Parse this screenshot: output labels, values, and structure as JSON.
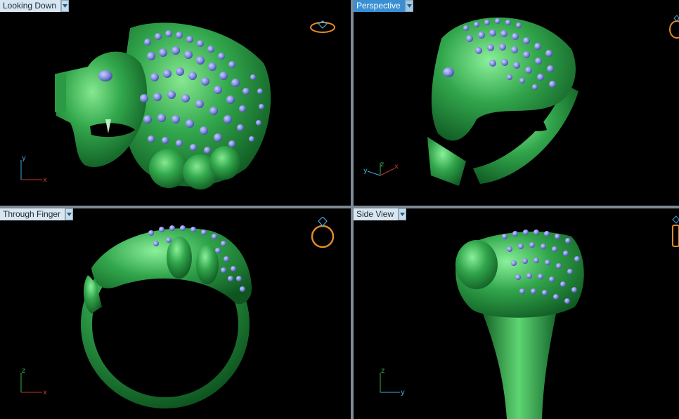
{
  "viewports": {
    "top_left": {
      "title": "Looking Down",
      "active": false,
      "axis_vertical": "y",
      "axis_horizontal": "x"
    },
    "top_right": {
      "title": "Perspective",
      "active": true,
      "axis_vertical": "z",
      "axis_left": "y",
      "axis_right": "x"
    },
    "bottom_left": {
      "title": "Through Finger",
      "active": false,
      "axis_vertical": "z",
      "axis_horizontal": "x"
    },
    "bottom_right": {
      "title": "Side View",
      "active": false,
      "axis_vertical": "z",
      "axis_horizontal": "y"
    }
  },
  "colors": {
    "viewport_bg": "#000000",
    "model_green": "#2fa14a",
    "model_highlight": "#7ee08a",
    "gem_blue": "#7f8fe0",
    "axis_red": "#c0392b",
    "axis_blue": "#3fa9e0",
    "axis_green": "#2fb24a",
    "ring_icon": "#e08a2a",
    "active_tab": "#3a8fd4"
  },
  "icons": {
    "tab_menu": "chevron-down-icon",
    "view_cube": "ring-icon"
  }
}
